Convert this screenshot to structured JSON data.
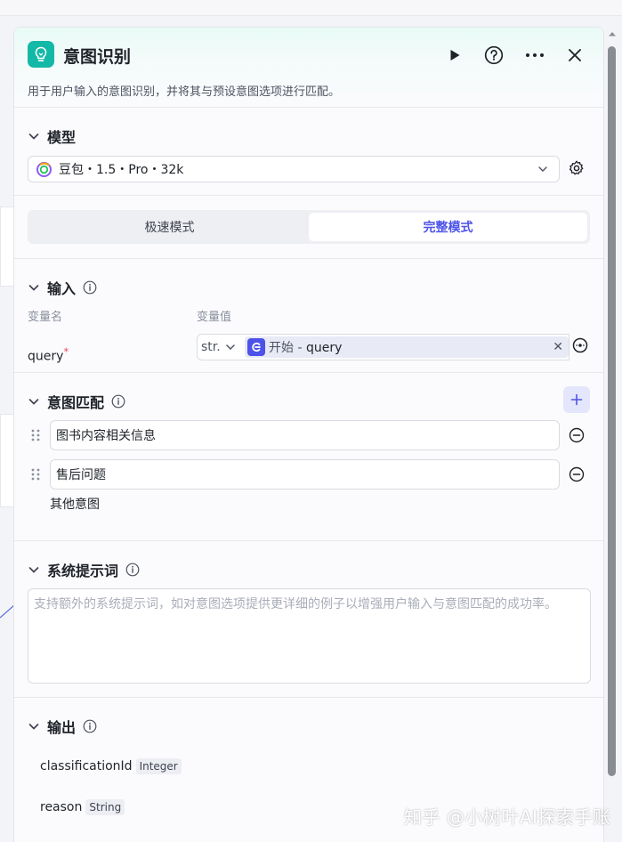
{
  "node": {
    "title": "意图识别",
    "description": "用于用户输入的意图识别，并将其与预设意图选项进行匹配。"
  },
  "model": {
    "section_title": "模型",
    "selected": "豆包・1.5・Pro・32k"
  },
  "mode": {
    "tabs": [
      {
        "label": "极速模式",
        "active": false
      },
      {
        "label": "完整模式",
        "active": true
      }
    ]
  },
  "input": {
    "section_title": "输入",
    "col_name": "变量名",
    "col_value": "变量值",
    "var_name": "query",
    "required_mark": "*",
    "type": "str.",
    "ref_source": "开始",
    "ref_sep": " - ",
    "ref_var": "query"
  },
  "intents": {
    "section_title": "意图匹配",
    "items": [
      "图书内容相关信息",
      "售后问题"
    ],
    "other": "其他意图"
  },
  "system_prompt": {
    "section_title": "系统提示词",
    "placeholder": "支持额外的系统提示词，如对意图选项提供更详细的例子以增强用户输入与意图匹配的成功率。"
  },
  "output": {
    "section_title": "输出",
    "fields": [
      {
        "name": "classificationId",
        "type": "Integer"
      },
      {
        "name": "reason",
        "type": "String"
      }
    ]
  },
  "watermark": "知乎 @小树叶AI探索手账",
  "colors": {
    "accent": "#4d53e8",
    "icon_bg": "#14b8a6",
    "required": "#f0445b"
  }
}
